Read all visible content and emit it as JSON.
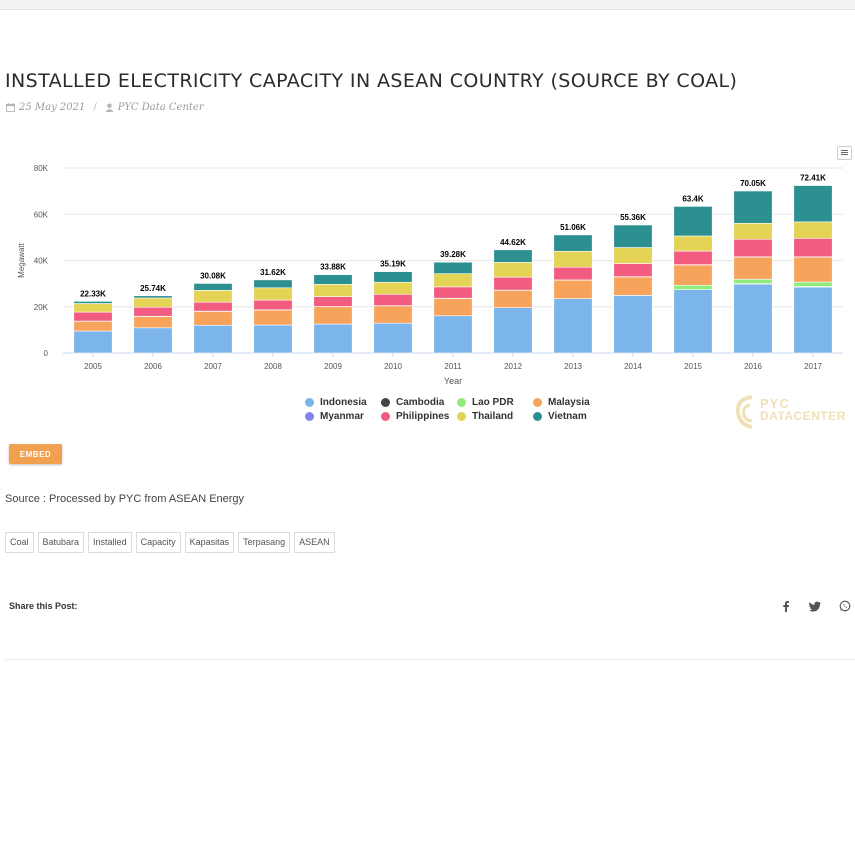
{
  "page": {
    "title": "INSTALLED ELECTRICITY CAPACITY IN ASEAN COUNTRY (SOURCE BY COAL)",
    "date": "25 May 2021",
    "author": "PYC Data Center",
    "embed_label": "EMBED",
    "source_text": "Source : Processed by PYC from ASEAN Energy",
    "tags": [
      "Coal",
      "Batubara",
      "Installed",
      "Capacity",
      "Kapasitas",
      "Terpasang",
      "ASEAN"
    ],
    "share_label": "Share this Post:",
    "social_icons": [
      "facebook-icon",
      "twitter-icon",
      "whatsapp-icon"
    ],
    "watermark": {
      "line1": "PYC",
      "line2": "DATACENTER"
    }
  },
  "chart_data": {
    "type": "bar",
    "stacked": true,
    "xlabel": "Year",
    "ylabel": "Megawatt",
    "ylim": [
      0,
      80000
    ],
    "yticks": [
      "0",
      "20K",
      "40K",
      "60K",
      "80K"
    ],
    "grid": true,
    "legend_position": "bottom",
    "categories": [
      "2005",
      "2006",
      "2007",
      "2008",
      "2009",
      "2010",
      "2011",
      "2012",
      "2013",
      "2014",
      "2015",
      "2016",
      "2017"
    ],
    "totals_labels": [
      "22.33K",
      "25.74K",
      "30.08K",
      "31.62K",
      "33.88K",
      "35.19K",
      "39.28K",
      "44.62K",
      "51.06K",
      "55.36K",
      "63.4K",
      "70.05K",
      "72.41K"
    ],
    "series": [
      {
        "name": "Indonesia",
        "color": "#7cb5ec",
        "values": [
          9500,
          10900,
          12000,
          12100,
          12500,
          12900,
          16100,
          19600,
          23500,
          24900,
          27400,
          29800,
          28500
        ]
      },
      {
        "name": "Cambodia",
        "color": "#434348",
        "values": [
          0,
          0,
          0,
          0,
          0,
          0,
          0,
          0,
          0,
          0,
          0,
          200,
          300
        ]
      },
      {
        "name": "Lao PDR",
        "color": "#90ed7d",
        "values": [
          0,
          0,
          0,
          0,
          0,
          0,
          0,
          0,
          0,
          0,
          1900,
          1900,
          1900
        ]
      },
      {
        "name": "Malaysia",
        "color": "#f7a35c",
        "values": [
          4200,
          4900,
          6000,
          6500,
          7500,
          7500,
          7500,
          7500,
          8000,
          8000,
          8800,
          9600,
          10800
        ]
      },
      {
        "name": "Myanmar",
        "color": "#8085e9",
        "values": [
          100,
          100,
          100,
          100,
          100,
          100,
          100,
          100,
          100,
          100,
          100,
          100,
          100
        ]
      },
      {
        "name": "Philippines",
        "color": "#f15c80",
        "values": [
          3900,
          3900,
          3900,
          4200,
          4300,
          4900,
          4900,
          5600,
          5500,
          5700,
          5900,
          7600,
          8000
        ]
      },
      {
        "name": "Thailand",
        "color": "#e4d354",
        "values": [
          3700,
          4000,
          5100,
          5300,
          5300,
          5200,
          5700,
          6400,
          6900,
          6900,
          6500,
          6900,
          7100
        ]
      },
      {
        "name": "Vietnam",
        "color": "#2b908f",
        "values": [
          930,
          940,
          2980,
          3420,
          4180,
          4590,
          4980,
          5420,
          7060,
          9760,
          12800,
          13950,
          15710
        ]
      }
    ]
  }
}
